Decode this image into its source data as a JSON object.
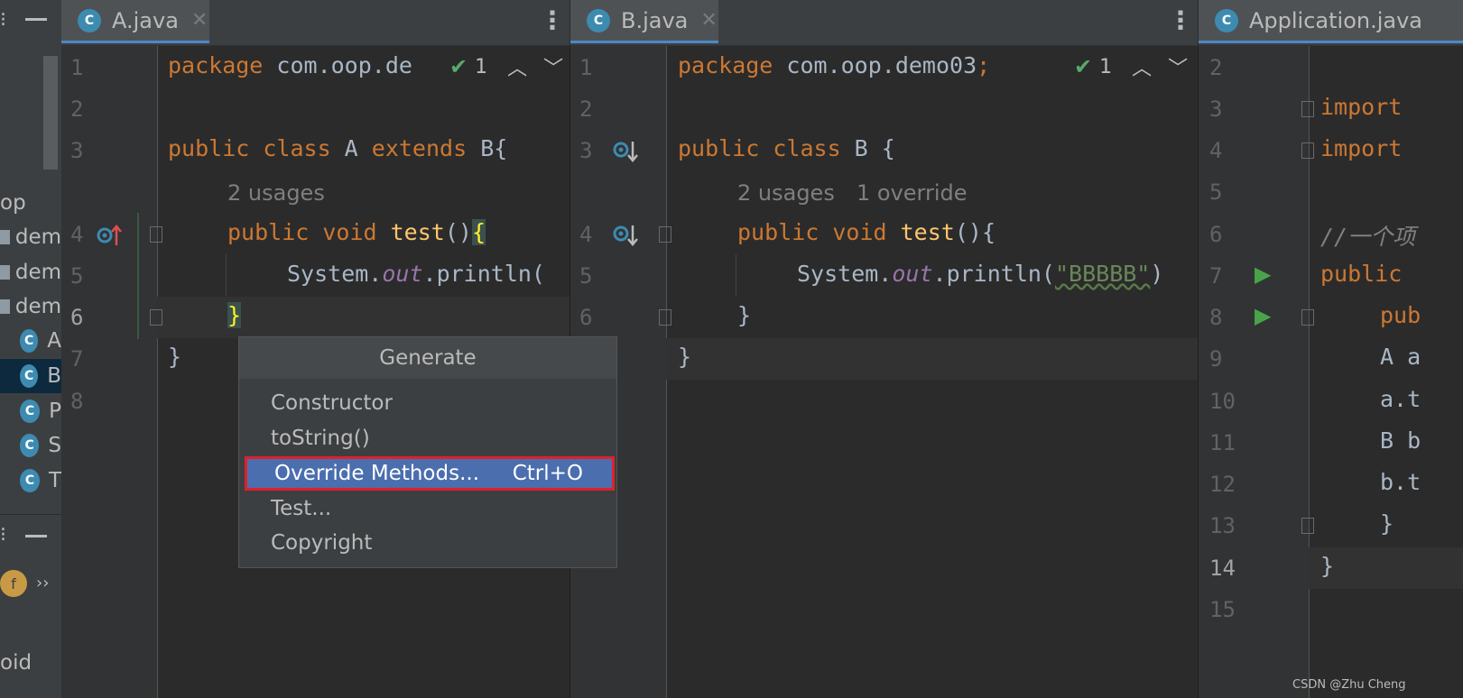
{
  "sidebar": {
    "items": [
      {
        "label": "op",
        "type": "module"
      },
      {
        "label": "dem",
        "type": "folder"
      },
      {
        "label": "dem",
        "type": "folder"
      },
      {
        "label": "dem",
        "type": "folder"
      },
      {
        "label": "A",
        "type": "class"
      },
      {
        "label": "B",
        "type": "class",
        "selected": true
      },
      {
        "label": "P",
        "type": "class"
      },
      {
        "label": "S",
        "type": "class"
      },
      {
        "label": "T",
        "type": "class"
      }
    ],
    "bottom_icon": "f",
    "bottom_chevron": "››",
    "bottom_text": "oid"
  },
  "tabs": [
    {
      "label": "A.java",
      "close": "✕"
    },
    {
      "label": "B.java",
      "close": "✕"
    },
    {
      "label": "Application.java"
    }
  ],
  "editors": {
    "a": {
      "inspection_count": "1",
      "lines": [
        "1",
        "2",
        "3",
        "4",
        "5",
        "6",
        "7",
        "8"
      ],
      "code": {
        "l1_kw": "package",
        "l1_rest": " com.oop.de",
        "l3_kw1": "public class",
        "l3_name": " A ",
        "l3_kw2": "extends",
        "l3_rest": " B{",
        "usages": "2 usages",
        "l4_kw": "public void",
        "l4_fn": " test",
        "l4_rest": "()",
        "l4_brace": "{",
        "l5_a": "System.",
        "l5_out": "out",
        "l5_b": ".println(",
        "l6": "}",
        "l7": "}"
      }
    },
    "b": {
      "inspection_count": "1",
      "lines": [
        "1",
        "2",
        "3",
        "4",
        "5",
        "6"
      ],
      "code": {
        "l1_kw": "package",
        "l1_rest": " com.oop.demo03",
        "l1_semi": ";",
        "l3_kw": "public class",
        "l3_rest": " B {",
        "usages": "2 usages",
        "overrides": "1 override",
        "l4_kw": "public void",
        "l4_fn": " test",
        "l4_rest": "(){",
        "l5_a": "System.",
        "l5_out": "out",
        "l5_b": ".println(",
        "l5_str": "\"BBBBB\"",
        "l5_c": ")",
        "l6": "}",
        "l7": "}"
      }
    },
    "app": {
      "lines": [
        "2",
        "3",
        "4",
        "5",
        "6",
        "7",
        "8",
        "9",
        "10",
        "11",
        "12",
        "13",
        "14",
        "15"
      ],
      "code": {
        "l3": "import",
        "l4": "import",
        "l6": "//一个项",
        "l7": "public",
        "l8": "pub",
        "l9": "A a",
        "l10": "a.t",
        "l11": "B b",
        "l12": "b.t",
        "l13": "}",
        "l14": "}"
      }
    }
  },
  "popup": {
    "title": "Generate",
    "items": [
      {
        "label": "Constructor"
      },
      {
        "label": "toString()"
      },
      {
        "label": "Override Methods...",
        "shortcut": "Ctrl+O",
        "selected": true
      },
      {
        "label": "Test..."
      },
      {
        "label": "Copyright"
      }
    ]
  },
  "watermark": "CSDN @Zhu Cheng",
  "colors": {
    "accent": "#4b6eaf",
    "highlight_border": "#e0202a",
    "keyword": "#cc7832",
    "function": "#ffc66d",
    "string": "#6a8759"
  }
}
